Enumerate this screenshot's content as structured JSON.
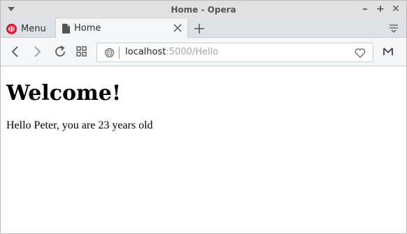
{
  "window": {
    "title": "Home - Opera",
    "controls": {
      "minimize": "–",
      "maximize": "+",
      "close": "✕"
    }
  },
  "tabstrip": {
    "menu_label": "Menu",
    "tabs": [
      {
        "title": "Home",
        "icon": "document-icon"
      }
    ]
  },
  "toolbar": {
    "url_host": "localhost",
    "url_path": ":5000/Hello"
  },
  "page": {
    "heading": "Welcome!",
    "message": "Hello Peter, you are 23 years old"
  },
  "colors": {
    "opera_red": "#e3162c",
    "tabstrip_bg": "#dde1e8",
    "toolbar_bg": "#f5f6f7",
    "titlebar_bg": "#e1e1e1"
  }
}
